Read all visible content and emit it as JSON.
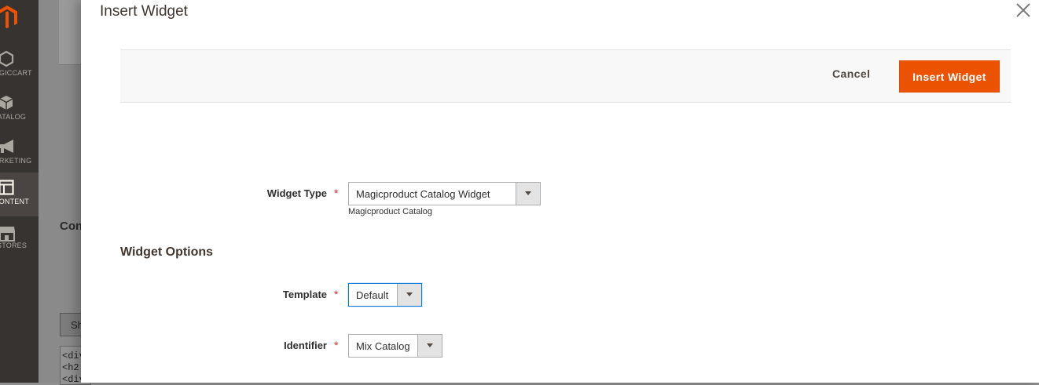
{
  "sidebar": {
    "items": [
      {
        "label": "MAGICCART",
        "icon": "hexagon-icon"
      },
      {
        "label": "CATALOG",
        "icon": "box-icon"
      },
      {
        "label": "MARKETING",
        "icon": "megaphone-icon"
      },
      {
        "label": "CONTENT",
        "icon": "layout-icon",
        "active": true
      },
      {
        "label": "STORES",
        "icon": "storefront-icon"
      }
    ]
  },
  "background": {
    "section_title": "Con",
    "button_label": "Sh",
    "code_lines": "<div\n<h2\n<div"
  },
  "modal": {
    "title": "Insert Widget",
    "cancel_label": "Cancel",
    "insert_label": "Insert Widget",
    "accent_color": "#eb5202",
    "widget_type": {
      "label": "Widget Type",
      "value": "Magicproduct Catalog Widget",
      "note": "Magicproduct Catalog"
    },
    "options_title": "Widget Options",
    "template": {
      "label": "Template",
      "value": "Default"
    },
    "identifier": {
      "label": "Identifier",
      "value": "Mix Catalog"
    }
  }
}
